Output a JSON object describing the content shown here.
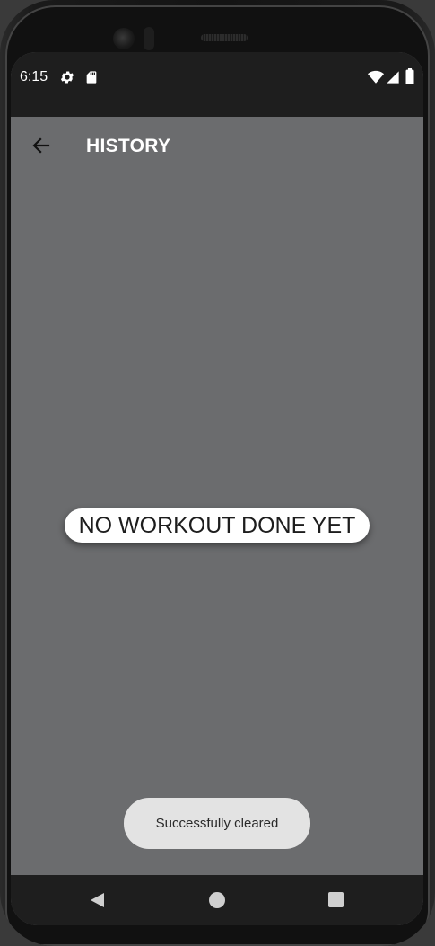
{
  "status_bar": {
    "time": "6:15",
    "icons": [
      "gear-icon",
      "sd-card-icon",
      "wifi-icon",
      "cell-signal-icon",
      "battery-icon"
    ]
  },
  "toolbar": {
    "title": "HISTORY",
    "back_icon": "arrow-left-icon"
  },
  "main": {
    "empty_text": "NO WORKOUT DONE YET"
  },
  "toast": {
    "text": "Successfully cleared"
  },
  "nav_bar": {
    "icons": [
      "nav-back-icon",
      "nav-home-icon",
      "nav-recents-icon"
    ]
  },
  "colors": {
    "screen_background": "#6b6c6e",
    "system_bars": "#1e1e1e",
    "toast_background": "#e3e3e3",
    "message_pill": "#ffffff"
  }
}
